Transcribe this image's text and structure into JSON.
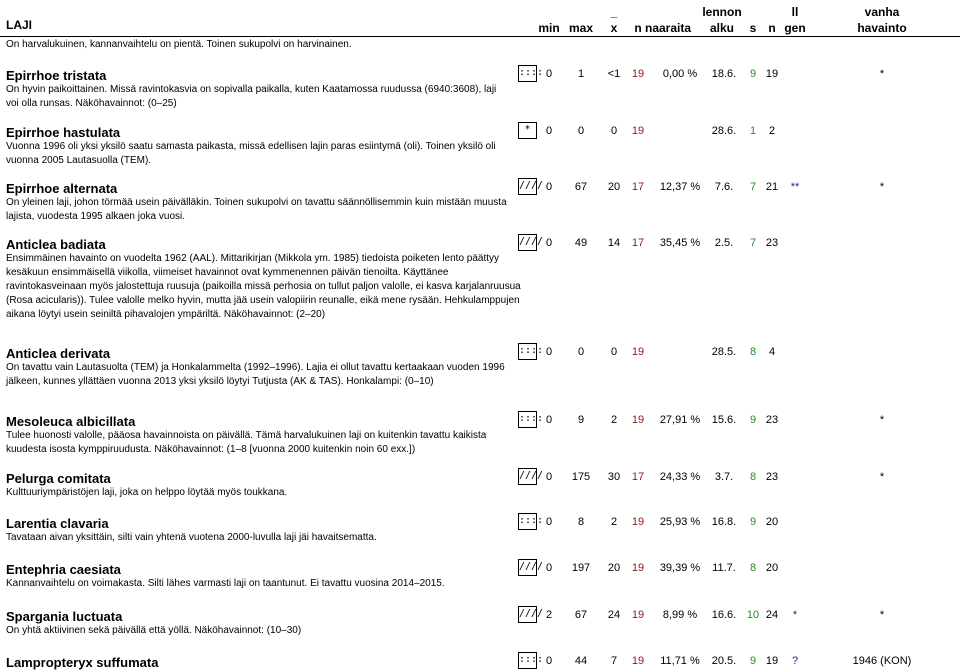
{
  "header": {
    "laji": "LAJI",
    "min": "min",
    "max": "max",
    "x": "x",
    "x_bar": "_",
    "n": "n",
    "naaraita": "naaraita",
    "lennon": "lennon",
    "alku": "alku",
    "s": "s",
    "n2": "n",
    "ll": "ll",
    "gen": "gen",
    "vanha": "vanha",
    "havainto": "havainto"
  },
  "intro": "On harvalukuinen, kannanvaihtelu on pientä. Toinen sukupolvi on harvinainen.",
  "entries": [
    {
      "name": "Epirrhoe tristata",
      "desc": "On hyvin paikoittainen. Missä ravintokasvia on sopivalla paikalla, kuten Kaatamossa ruudussa (6940:3608), laji voi olla runsas. Näköhavainnot: (0–25)",
      "box": "::::",
      "min": "0",
      "max": "1",
      "x": "<1",
      "n": "19",
      "naaraita": "0,00 %",
      "alku": "18.6.",
      "s": "9",
      "n2": "19",
      "gen": "",
      "vanha": "*"
    },
    {
      "name": "Epirrhoe hastulata",
      "desc": "Vuonna 1996 oli yksi yksilö saatu samasta paikasta, missä edellisen lajin paras esiintymä (oli). Toinen yksilö oli vuonna 2005 Lautasuolla (TEM).",
      "box": "*",
      "min": "0",
      "max": "0",
      "x": "0",
      "n": "19",
      "naaraita": "",
      "alku": "28.6.",
      "s": "1",
      "n2": "2",
      "gen": "",
      "vanha": ""
    },
    {
      "name": "Epirrhoe alternata",
      "desc": "On yleinen laji, johon törmää usein päivälläkin. Toinen sukupolvi on tavattu säännöllisemmin kuin mistään muusta lajista, vuodesta 1995 alkaen joka vuosi.",
      "box": "////",
      "min": "0",
      "max": "67",
      "x": "20",
      "n": "17",
      "naaraita": "12,37 %",
      "alku": "7.6.",
      "s": "7",
      "n2": "21",
      "gen": "**",
      "vanha": "*"
    },
    {
      "name": "Anticlea badiata",
      "desc": "Ensimmäinen havainto on vuodelta 1962 (AAL). Mittarikirjan (Mikkola ym. 1985) tiedoista poiketen lento päättyy kesäkuun ensimmäisellä viikolla, viimeiset havainnot ovat kymmenennen päivän tienoilta. Käyttänee ravintokasveinaan myös jalostettuja ruusuja (paikoilla missä perhosia on tullut paljon valolle, ei kasva karjalanruusua (Rosa acicularis)). Tulee valolle melko hyvin, mutta jää usein valopiirin reunalle, eikä mene rysään. Hehkulamppujen aikana löytyi usein seiniltä pihavalojen ympäriltä. Näköhavainnot: (2–20)",
      "box": "////",
      "min": "0",
      "max": "49",
      "x": "14",
      "n": "17",
      "naaraita": "35,45 %",
      "alku": "2.5.",
      "s": "7",
      "n2": "23",
      "gen": "",
      "vanha": ""
    },
    {
      "name": "Anticlea derivata",
      "desc": "On tavattu vain Lautasuolta (TEM) ja Honkalammelta (1992–1996). Lajia ei ollut tavattu kertaakaan vuoden 1996 jälkeen, kunnes yllättäen vuonna 2013 yksi yksilö löytyi Tutjusta (AK & TAS). Honkalampi: (0–10)",
      "box": "::::",
      "min": "0",
      "max": "0",
      "x": "0",
      "n": "19",
      "naaraita": "",
      "alku": "28.5.",
      "s": "8",
      "n2": "4",
      "gen": "",
      "vanha": ""
    },
    {
      "name": "Mesoleuca albicillata",
      "desc": "Tulee huonosti valolle, pääosa havainnoista on päivällä. Tämä harvalukuinen laji on kuitenkin tavattu kaikista kuudesta isosta kymppiruudusta. Näköhavainnot: (1–8 [vuonna 2000 kuitenkin noin 60 exx.])",
      "box": "::::",
      "min": "0",
      "max": "9",
      "x": "2",
      "n": "19",
      "naaraita": "27,91 %",
      "alku": "15.6.",
      "s": "9",
      "n2": "23",
      "gen": "",
      "vanha": "*"
    },
    {
      "name": "Pelurga comitata",
      "desc": "Kulttuuriympäristöjen laji, joka on helppo löytää myös toukkana.",
      "box": "////",
      "min": "0",
      "max": "175",
      "x": "30",
      "n": "17",
      "naaraita": "24,33 %",
      "alku": "3.7.",
      "s": "8",
      "n2": "23",
      "gen": "",
      "vanha": "*"
    },
    {
      "name": "Larentia clavaria",
      "desc": "Tavataan aivan yksittäin, silti vain yhtenä vuotena 2000-luvulla laji jäi havaitsematta.",
      "box": "::::",
      "min": "0",
      "max": "8",
      "x": "2",
      "n": "19",
      "naaraita": "25,93 %",
      "alku": "16.8.",
      "s": "9",
      "n2": "20",
      "gen": "",
      "vanha": ""
    },
    {
      "name": "Entephria caesiata",
      "desc": "Kannanvaihtelu on voimakasta. Silti lähes varmasti laji on taantunut. Ei tavattu vuosina 2014–2015.",
      "box": "////",
      "min": "0",
      "max": "197",
      "x": "20",
      "n": "19",
      "naaraita": "39,39 %",
      "alku": "11.7.",
      "s": "8",
      "n2": "20",
      "gen": "",
      "vanha": ""
    },
    {
      "name": "Spargania luctuata",
      "desc": "On yhtä aktiivinen sekä päivällä että yöllä. Näköhavainnot: (10–30)",
      "box": "////",
      "min": "2",
      "max": "67",
      "x": "24",
      "n": "19",
      "naaraita": "8,99 %",
      "alku": "16.6.",
      "s": "10",
      "n2": "24",
      "gen": "*",
      "vanha": "*"
    },
    {
      "name": "Lampropteryx suffumata",
      "desc": "",
      "box": "::::",
      "min": "0",
      "max": "44",
      "x": "7",
      "n": "19",
      "naaraita": "11,71 %",
      "alku": "20.5.",
      "s": "9",
      "n2": "19",
      "gen": "?",
      "vanha": "1946 (KON)"
    }
  ]
}
